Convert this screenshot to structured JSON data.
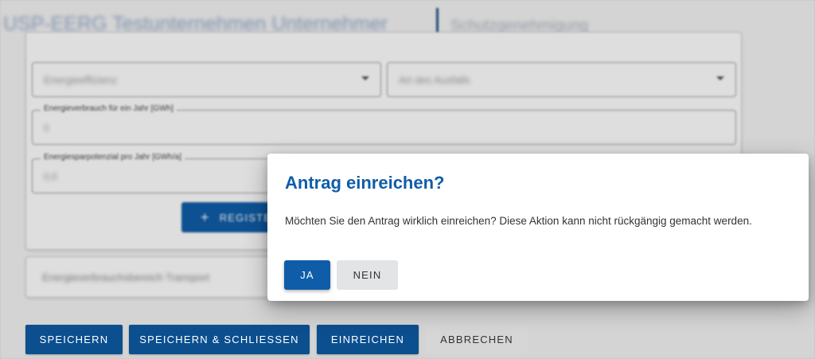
{
  "header": {
    "title": "USP-EERG Testunternehmen Unternehmer",
    "subtitle": "Schutzgenehmigung"
  },
  "form": {
    "select_category": {
      "value": "Energieeffizienz"
    },
    "select_type": {
      "value": "Art des Ausfalls"
    },
    "consumption": {
      "label": "Energieverbrauch für ein Jahr [GWh]",
      "value": "0"
    },
    "savings": {
      "label": "Energiesparpotenzial pro Jahr [GWh/a]",
      "value": "0,0"
    },
    "register_button": {
      "label": "REGISTE",
      "icon": "plus-icon"
    },
    "section_transport": {
      "label": "Energieverbrauchsbereich Transport"
    }
  },
  "actions": {
    "save": "SPEICHERN",
    "save_close": "SPEICHERN & SCHLIESSEN",
    "submit": "EINREICHEN",
    "cancel": "ABBRECHEN"
  },
  "dialog": {
    "title": "Antrag einreichen?",
    "message": "Möchten Sie den Antrag wirklich einreichen? Diese Aktion kann nicht rückgängig gemacht werden.",
    "yes": "JA",
    "no": "NEIN"
  },
  "colors": {
    "primary": "#0f5da8",
    "primary_dark": "#0b4f8f",
    "secondary": "#d6d6d6"
  }
}
